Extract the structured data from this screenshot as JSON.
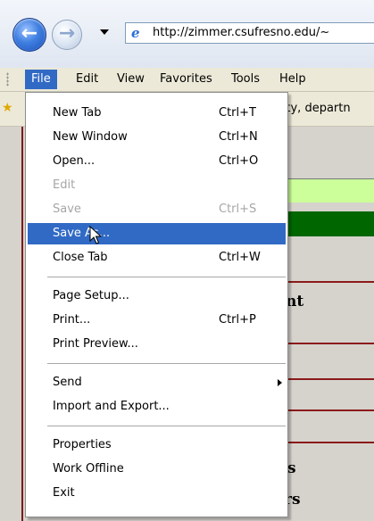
{
  "toolbar": {
    "back_icon": "back-arrow-icon",
    "forward_icon": "forward-arrow-icon",
    "url": "http://zimmer.csufresno.edu/~"
  },
  "menubar": {
    "items": [
      "File",
      "Edit",
      "View",
      "Favorites",
      "Tools",
      "Help"
    ]
  },
  "favorites_bar": {
    "partial_text": "sity, departn"
  },
  "page": {
    "frag_nt": "nt",
    "frag_s1": "s",
    "frag_s2": "rs"
  },
  "file_menu": {
    "new_tab": {
      "label": "New Tab",
      "shortcut": "Ctrl+T"
    },
    "new_window": {
      "label": "New Window",
      "shortcut": "Ctrl+N"
    },
    "open": {
      "label": "Open...",
      "shortcut": "Ctrl+O"
    },
    "edit": {
      "label": "Edit"
    },
    "save": {
      "label": "Save",
      "shortcut": "Ctrl+S"
    },
    "save_as": {
      "label": "Save As..."
    },
    "close_tab": {
      "label": "Close Tab",
      "shortcut": "Ctrl+W"
    },
    "page_setup": {
      "label": "Page Setup..."
    },
    "print": {
      "label": "Print...",
      "shortcut": "Ctrl+P"
    },
    "print_preview": {
      "label": "Print Preview..."
    },
    "send": {
      "label": "Send"
    },
    "import_export": {
      "label": "Import and Export..."
    },
    "properties": {
      "label": "Properties"
    },
    "work_offline": {
      "label": "Work Offline"
    },
    "exit": {
      "label": "Exit"
    }
  },
  "colors": {
    "selection": "#316ac5",
    "disabled_text": "#a6a6a6",
    "page_green_light": "#ccff99",
    "page_green_dark": "#006600",
    "page_rule": "#8b1a1a"
  }
}
